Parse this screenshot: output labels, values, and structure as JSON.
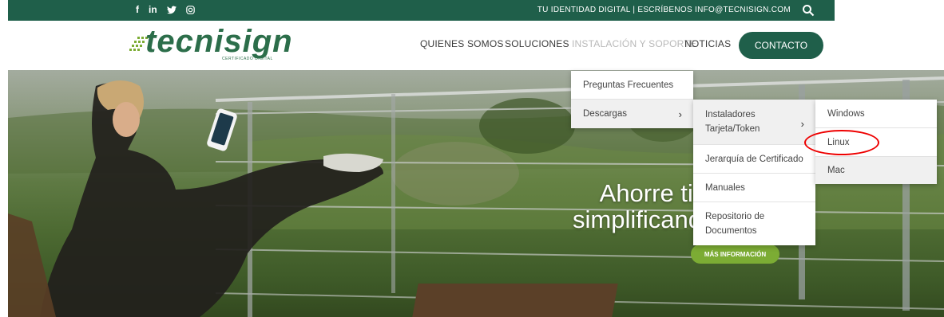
{
  "topbar": {
    "social": [
      "f",
      "in",
      "𝕪",
      "◎"
    ],
    "text": "TU IDENTIDAD DIGITAL | ESCRÍBENOS INFO@TECNISIGN.COM"
  },
  "header": {
    "logo_text": "tecnisign",
    "logo_subtitle": "CERTIFICADO DIGITAL",
    "nav": [
      "QUIENES SOMOS",
      "SOLUCIONES",
      "INSTALACIÓN Y SOPORTE",
      "NOTICIAS"
    ],
    "contact": "CONTACTO"
  },
  "hero": {
    "title_line1": "Ahorre tiempo",
    "title_line2": "simplificando sus p",
    "button": "MÁS INFORMACIÓN"
  },
  "menu1": [
    "Preguntas Frecuentes",
    "Descargas"
  ],
  "menu2": [
    "Instaladores",
    "Tarjeta/Token",
    "Jerarquía de Certificado",
    "Manuales",
    "Repositorio de",
    "Documentos"
  ],
  "menu3": [
    "Windows",
    "Linux",
    "Mac"
  ],
  "colors": {
    "brand": "#1f5f4a",
    "accent": "#7cac34",
    "highlight": "#e00000"
  }
}
